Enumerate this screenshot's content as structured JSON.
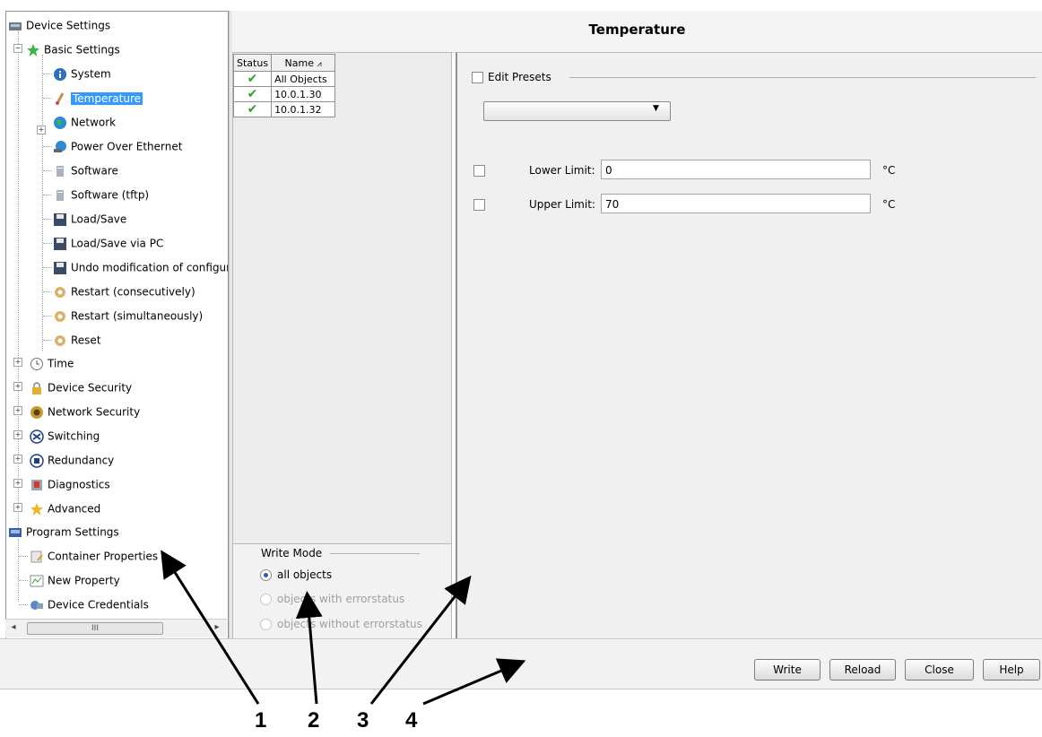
{
  "tree": {
    "root": "Device Settings",
    "basic_settings": "Basic Settings",
    "items": [
      {
        "label": "System",
        "icon": "info-icon"
      },
      {
        "label": "Temperature",
        "icon": "thermometer-icon",
        "selected": true
      },
      {
        "label": "Network",
        "icon": "globe-icon"
      },
      {
        "label": "Power Over Ethernet",
        "icon": "poe-icon"
      },
      {
        "label": "Software",
        "icon": "software-icon"
      },
      {
        "label": "Software (tftp)",
        "icon": "software-icon"
      },
      {
        "label": "Load/Save",
        "icon": "floppy-icon"
      },
      {
        "label": "Load/Save via PC",
        "icon": "floppy-icon"
      },
      {
        "label": "Undo modification of configur",
        "icon": "floppy-icon"
      },
      {
        "label": "Restart (consecutively)",
        "icon": "restart-icon"
      },
      {
        "label": "Restart (simultaneously)",
        "icon": "restart-icon"
      },
      {
        "label": "Reset",
        "icon": "reset-icon"
      }
    ],
    "groups": [
      {
        "label": "Time",
        "icon": "clock-icon"
      },
      {
        "label": "Device Security",
        "icon": "lock-icon"
      },
      {
        "label": "Network Security",
        "icon": "badge-icon"
      },
      {
        "label": "Switching",
        "icon": "switch-icon"
      },
      {
        "label": "Redundancy",
        "icon": "redundancy-icon"
      },
      {
        "label": "Diagnostics",
        "icon": "diagnostics-icon"
      },
      {
        "label": "Advanced",
        "icon": "star-icon"
      }
    ],
    "program_settings": "Program Settings",
    "program_items": [
      {
        "label": "Container Properties",
        "icon": "container-icon"
      },
      {
        "label": "New Property",
        "icon": "chart-icon"
      },
      {
        "label": "Device Credentials",
        "icon": "credentials-icon"
      }
    ],
    "scroll_thumb": "III"
  },
  "title": "Temperature",
  "objects": {
    "headers": {
      "status": "Status",
      "name": "Name"
    },
    "rows": [
      {
        "status": "ok",
        "name": "All Objects"
      },
      {
        "status": "ok",
        "name": "10.0.1.30"
      },
      {
        "status": "ok",
        "name": "10.0.1.32"
      }
    ]
  },
  "write_mode": {
    "label": "Write Mode",
    "options": [
      {
        "label": "all objects",
        "selected": true,
        "enabled": true
      },
      {
        "label": "objects with errorstatus",
        "selected": false,
        "enabled": false
      },
      {
        "label": "objects without errorstatus",
        "selected": false,
        "enabled": false
      }
    ]
  },
  "edit_presets": {
    "label": "Edit Presets",
    "checked": false,
    "selected_preset": ""
  },
  "limits": {
    "lower": {
      "label": "Lower Limit:",
      "value": "0",
      "unit": "°C",
      "checked": false
    },
    "upper": {
      "label": "Upper Limit:",
      "value": "70",
      "unit": "°C",
      "checked": false
    }
  },
  "buttons": {
    "write": "Write",
    "reload": "Reload",
    "close": "Close",
    "help": "Help"
  },
  "callouts": [
    "1",
    "2",
    "3",
    "4"
  ],
  "colors": {
    "selection": "#3399ff",
    "check": "#2fa12f",
    "arrow": "#000000"
  }
}
